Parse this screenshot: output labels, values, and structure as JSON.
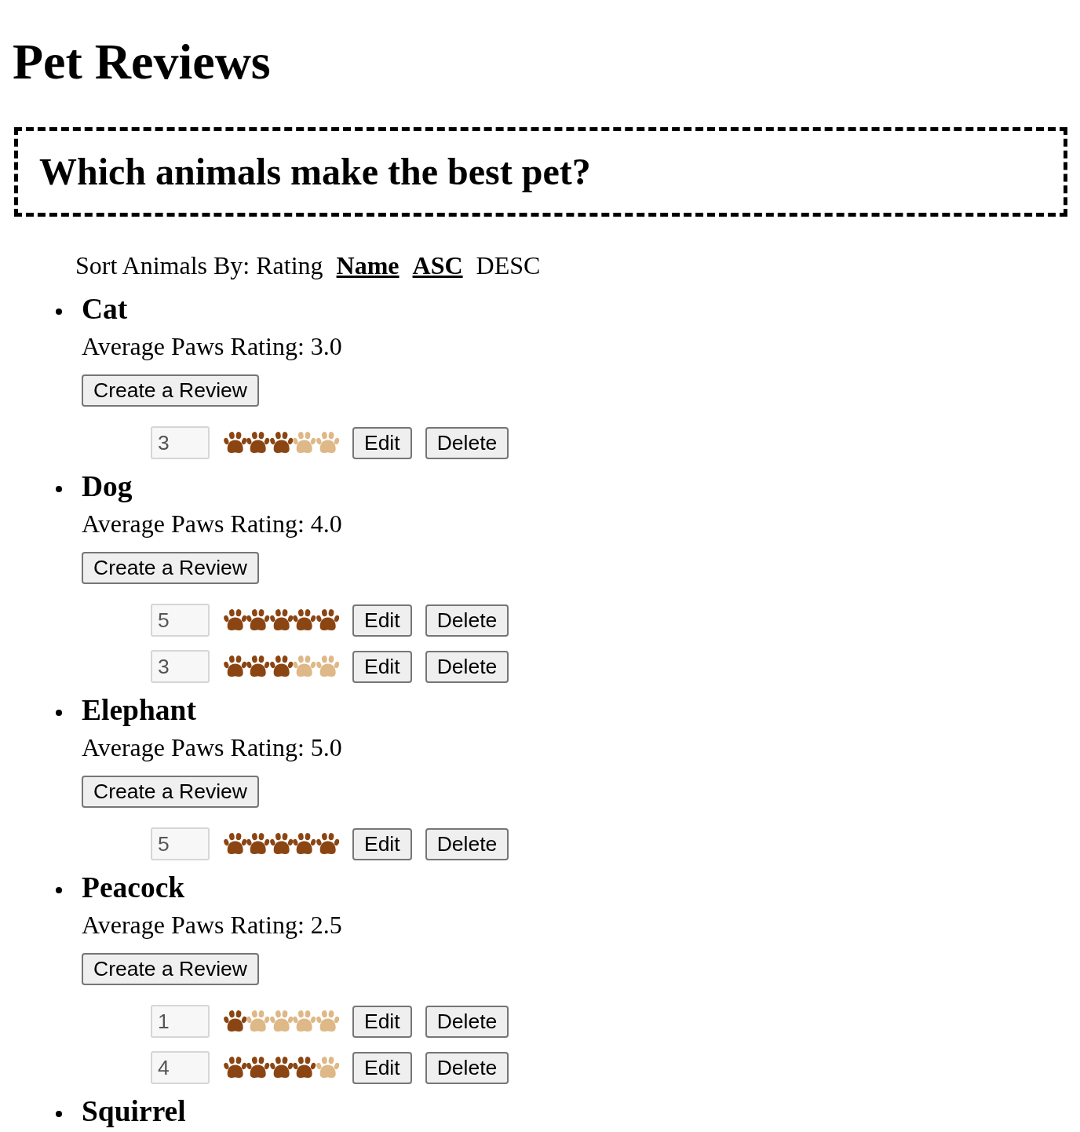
{
  "page": {
    "title": "Pet Reviews"
  },
  "question": {
    "title": "Which animals make the best pet?"
  },
  "sort": {
    "label": "Sort Animals By:",
    "fields": [
      {
        "label": "Rating",
        "selected": false
      },
      {
        "label": "Name",
        "selected": true
      }
    ],
    "orders": [
      {
        "label": "ASC",
        "selected": true
      },
      {
        "label": "DESC",
        "selected": false
      }
    ]
  },
  "animals": [
    {
      "name": "Cat",
      "rating": "Average Paws Rating: 3.0",
      "create_button": "Create a Review",
      "reviews": [
        {
          "value": "3",
          "disabled": true,
          "stars": 3,
          "edit_button": "Edit",
          "delete_button": "Delete"
        }
      ]
    },
    {
      "name": "Dog",
      "rating": "Average Paws Rating: 4.0",
      "create_button": "Create a Review",
      "reviews": [
        {
          "value": "5",
          "disabled": true,
          "stars": 5,
          "edit_button": "Edit",
          "delete_button": "Delete"
        },
        {
          "value": "3",
          "disabled": true,
          "stars": 3,
          "edit_button": "Edit",
          "delete_button": "Delete"
        }
      ]
    },
    {
      "name": "Elephant",
      "rating": "Average Paws Rating: 5.0",
      "create_button": "Create a Review",
      "reviews": [
        {
          "value": "5",
          "disabled": true,
          "stars": 5,
          "edit_button": "Edit",
          "delete_button": "Delete"
        }
      ]
    },
    {
      "name": "Peacock",
      "rating": "Average Paws Rating: 2.5",
      "create_button": "Create a Review",
      "reviews": [
        {
          "value": "1",
          "disabled": true,
          "stars": 1,
          "edit_button": "Edit",
          "delete_button": "Delete"
        },
        {
          "value": "4",
          "disabled": true,
          "stars": 4,
          "edit_button": "Edit",
          "delete_button": "Delete"
        }
      ]
    },
    {
      "name": "Squirrel"
    }
  ]
}
